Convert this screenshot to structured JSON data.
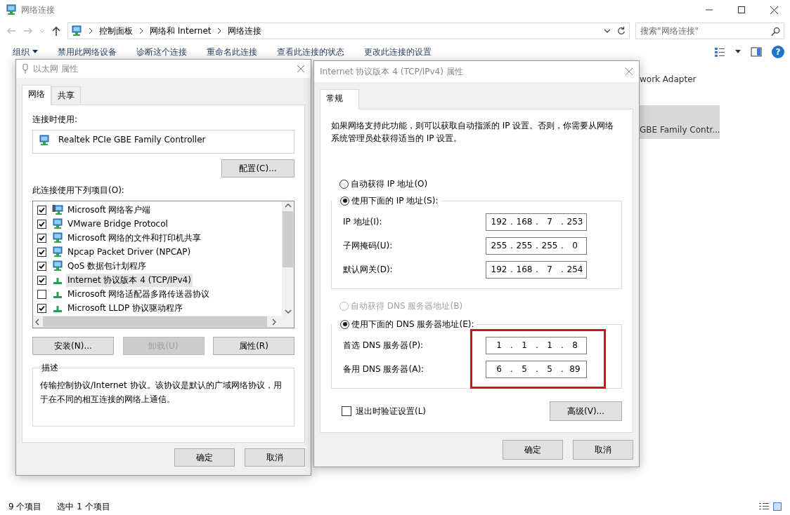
{
  "window": {
    "title": "网络连接"
  },
  "address_bar": {
    "breadcrumbs": [
      "控制面板",
      "网络和 Internet",
      "网络连接"
    ]
  },
  "search": {
    "placeholder": "搜索\"网络连接\""
  },
  "toolbar": {
    "items": [
      {
        "label": "组织",
        "kind": "menu"
      },
      {
        "label": "禁用此网络设备",
        "kind": "command"
      },
      {
        "label": "诊断这个连接",
        "kind": "command"
      },
      {
        "label": "重命名此连接",
        "kind": "command"
      },
      {
        "label": "查看此连接的状态",
        "kind": "command"
      },
      {
        "label": "更改此连接的设置",
        "kind": "command"
      }
    ],
    "help": "?"
  },
  "content": {
    "items": [
      {
        "label": "work Adapter",
        "selected": false
      },
      {
        "label": "GBE Family Contr...",
        "selected": true
      }
    ]
  },
  "status_bar": {
    "count": "9 个项目",
    "selection": "选中 1 个项目"
  },
  "ethernet_dialog": {
    "title": "以太网 属性",
    "tabs": [
      {
        "label": "网络",
        "selected": true
      },
      {
        "label": "共享",
        "selected": false
      }
    ],
    "connect_using_label": "连接时使用:",
    "adapter": "Realtek PCIe GBE Family Controller",
    "configure_button": "配置(C)...",
    "items_label": "此连接使用下列项目(O):",
    "items": [
      {
        "label": "Microsoft 网络客户端",
        "kind": "client",
        "checked": true,
        "selected": false
      },
      {
        "label": "VMware Bridge Protocol",
        "kind": "service",
        "checked": true,
        "selected": false
      },
      {
        "label": "Microsoft 网络的文件和打印机共享",
        "kind": "service",
        "checked": true,
        "selected": false
      },
      {
        "label": "Npcap Packet Driver (NPCAP)",
        "kind": "service",
        "checked": true,
        "selected": false
      },
      {
        "label": "QoS 数据包计划程序",
        "kind": "service",
        "checked": true,
        "selected": false
      },
      {
        "label": "Internet 协议版本 4 (TCP/IPv4)",
        "kind": "protocol",
        "checked": true,
        "selected": true
      },
      {
        "label": "Microsoft 网络适配器多路传送器协议",
        "kind": "protocol",
        "checked": false,
        "selected": false
      },
      {
        "label": "Microsoft LLDP 协议驱动程序",
        "kind": "protocol",
        "checked": true,
        "selected": false
      }
    ],
    "buttons": [
      {
        "label": "安装(N)...",
        "disabled": false
      },
      {
        "label": "卸载(U)",
        "disabled": true
      },
      {
        "label": "属性(R)",
        "disabled": false
      }
    ],
    "description": {
      "legend": "描述",
      "text": "传输控制协议/Internet 协议。该协议是默认的广域网络协议，用于在不同的相互连接的网络上通信。"
    },
    "footer_buttons": [
      "确定",
      "取消"
    ]
  },
  "ipv4_dialog": {
    "title": "Internet 协议版本 4 (TCP/IPv4) 属性",
    "tabs": [
      {
        "label": "常规",
        "selected": true
      }
    ],
    "intro": "如果网络支持此功能，则可以获取自动指派的 IP 设置。否则，你需要从网络系统管理员处获得适当的 IP 设置。",
    "separator": ".",
    "ip_auto": {
      "label": "自动获得 IP 地址(O)",
      "selected": false,
      "disabled": false
    },
    "ip_manual": {
      "label": "使用下面的 IP 地址(S):",
      "selected": true,
      "disabled": false
    },
    "ip_fields": [
      {
        "label": "IP 地址(I):",
        "octets": [
          "192",
          "168",
          "7",
          "253"
        ]
      },
      {
        "label": "子网掩码(U):",
        "octets": [
          "255",
          "255",
          "255",
          "0"
        ]
      },
      {
        "label": "默认网关(D):",
        "octets": [
          "192",
          "168",
          "7",
          "254"
        ]
      }
    ],
    "dns_auto": {
      "label": "自动获得 DNS 服务器地址(B)",
      "selected": false,
      "disabled": true
    },
    "dns_manual": {
      "label": "使用下面的 DNS 服务器地址(E):",
      "selected": true,
      "disabled": false
    },
    "dns_fields": [
      {
        "label": "首选 DNS 服务器(P):",
        "octets": [
          "1",
          "1",
          "1",
          "8"
        ]
      },
      {
        "label": "备用 DNS 服务器(A):",
        "octets": [
          "6",
          "5",
          "5",
          "89"
        ]
      }
    ],
    "dns_highlighted": true,
    "validate": {
      "label": "退出时验证设置(L)",
      "checked": false
    },
    "advanced_button": "高级(V)...",
    "footer_buttons": [
      "确定",
      "取消"
    ]
  }
}
